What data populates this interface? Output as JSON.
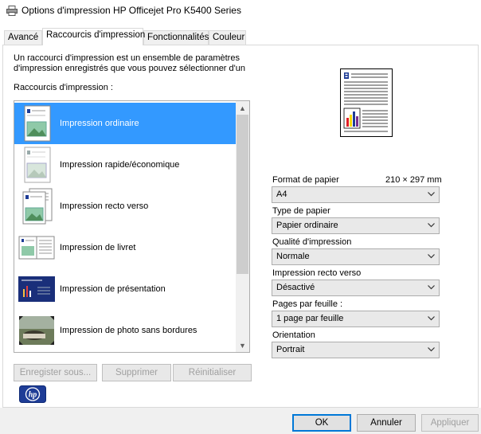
{
  "window": {
    "title": "Options d'impression HP Officejet Pro K5400 Series",
    "icon": "printer-icon"
  },
  "tabs": [
    {
      "label": "Avancé",
      "active": false
    },
    {
      "label": "Raccourcis d'impression",
      "active": true
    },
    {
      "label": "Fonctionnalités",
      "active": false
    },
    {
      "label": "Couleur",
      "active": false
    }
  ],
  "shortcuts": {
    "description_line1": "Un raccourci d'impression est un ensemble de paramètres",
    "description_line2": "d'impression enregistrés que vous pouvez sélectionner d'un",
    "list_label": "Raccourcis d'impression :",
    "items": [
      {
        "label": "Impression ordinaire",
        "icon": "document-image-icon",
        "selected": true
      },
      {
        "label": "Impression rapide/économique",
        "icon": "document-image-icon",
        "selected": false
      },
      {
        "label": "Impression recto verso",
        "icon": "duplex-document-icon",
        "selected": false
      },
      {
        "label": "Impression de livret",
        "icon": "booklet-icon",
        "selected": false
      },
      {
        "label": "Impression de présentation",
        "icon": "presentation-icon",
        "selected": false
      },
      {
        "label": "Impression de photo sans bordures",
        "icon": "photo-icon",
        "selected": false
      }
    ],
    "buttons": {
      "save": "Enregister sous...",
      "delete": "Supprimer",
      "reset": "Réinitialiser"
    }
  },
  "settings": {
    "paper_size": {
      "label": "Format de papier",
      "dimensions": "210 × 297 mm",
      "value": "A4"
    },
    "paper_type": {
      "label": "Type de papier",
      "value": "Papier ordinaire"
    },
    "print_quality": {
      "label": "Qualité d'impression",
      "value": "Normale"
    },
    "duplex": {
      "label": "Impression recto verso",
      "value": "Désactivé"
    },
    "pages_per_sheet": {
      "label": "Pages par feuille :",
      "value": "1 page par feuille"
    },
    "orientation": {
      "label": "Orientation",
      "value": "Portrait"
    }
  },
  "dialog_buttons": {
    "ok": "OK",
    "cancel": "Annuler",
    "apply": "Appliquer"
  },
  "colors": {
    "selection": "#3399ff",
    "accent": "#0078d7",
    "hp_blue": "#1e3c96"
  }
}
